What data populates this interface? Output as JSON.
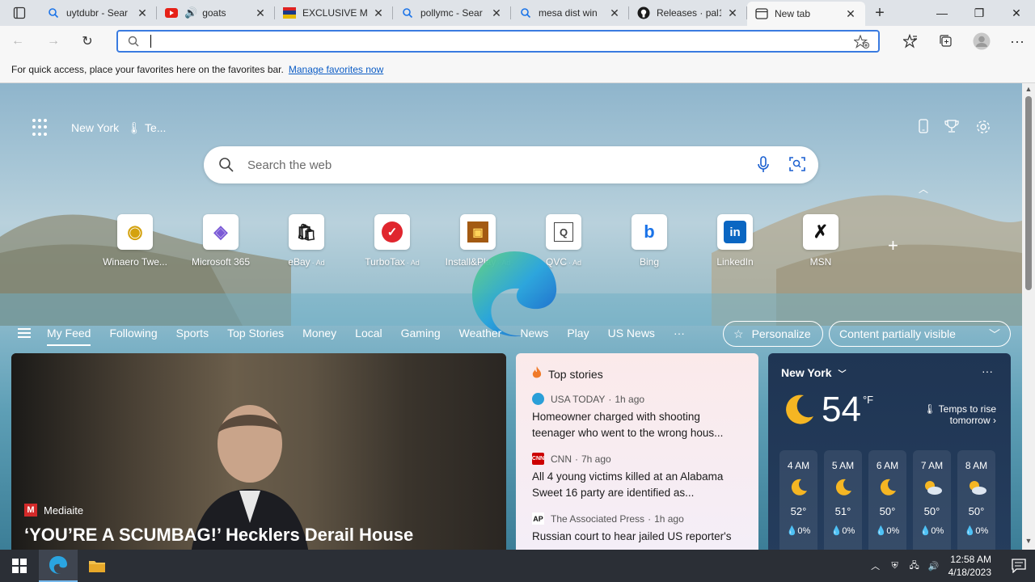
{
  "tabs": [
    {
      "label": "uytdubr - Sear",
      "icon": "bing-search-icon"
    },
    {
      "label": "goats",
      "icon": "youtube-icon"
    },
    {
      "label": "EXCLUSIVE Mr",
      "icon": "news-icon"
    },
    {
      "label": "pollymc - Sear",
      "icon": "bing-search-icon"
    },
    {
      "label": "mesa dist win",
      "icon": "bing-search-icon"
    },
    {
      "label": "Releases · pal1",
      "icon": "github-icon"
    },
    {
      "label": "New tab",
      "icon": "newtab-icon",
      "active": true
    }
  ],
  "address": {
    "value": "",
    "placeholder": ""
  },
  "favorites_bar": {
    "text": "For quick access, place your favorites here on the favorites bar.",
    "link": "Manage favorites now"
  },
  "header": {
    "location": "New York",
    "weather_snippet": "Te..."
  },
  "search": {
    "placeholder": "Search the web"
  },
  "quick_links": [
    {
      "name": "Winaero Twe...",
      "ad": false,
      "glyph": "◉",
      "color": "#d4a20f"
    },
    {
      "name": "Microsoft 365",
      "ad": false,
      "glyph": "◈",
      "color": "#7b5ad6"
    },
    {
      "name": "eBay",
      "ad": true,
      "glyph": "🛍",
      "color": "#1b1b1b"
    },
    {
      "name": "TurboTax",
      "ad": true,
      "glyph": "✓",
      "color": "#e0262e"
    },
    {
      "name": "Install&Play",
      "ad": true,
      "glyph": "▣",
      "color": "#a35a12"
    },
    {
      "name": "QVC",
      "ad": true,
      "glyph": "Q",
      "color": "#444444"
    },
    {
      "name": "Bing",
      "ad": false,
      "glyph": "b",
      "color": "#1a73e8"
    },
    {
      "name": "LinkedIn",
      "ad": false,
      "glyph": "in",
      "color": "#0a66c2"
    },
    {
      "name": "MSN",
      "ad": false,
      "glyph": "✗",
      "color": "#111111"
    }
  ],
  "ad_label": "· Ad",
  "feed_nav": {
    "items": [
      "My Feed",
      "Following",
      "Sports",
      "Top Stories",
      "Money",
      "Local",
      "Gaming",
      "Weather",
      "News",
      "Play",
      "US News"
    ],
    "more": "···",
    "personalize": "Personalize",
    "visibility": "Content partially visible"
  },
  "hero": {
    "source": "Mediaite",
    "headline": "‘YOU’RE A SCUMBAG!’ Hecklers Derail House"
  },
  "top_stories": {
    "title": "Top stories",
    "items": [
      {
        "source": "USA TODAY",
        "age": "1h ago",
        "logo_color": "#2a9fd8",
        "logo_text": "",
        "title": "Homeowner charged with shooting teenager who went to the wrong hous..."
      },
      {
        "source": "CNN",
        "age": "7h ago",
        "logo_color": "#cc0000",
        "logo_text": "CNN",
        "title": "All 4 young victims killed at an Alabama Sweet 16 party are identified as..."
      },
      {
        "source": "The Associated Press",
        "age": "1h ago",
        "logo_color": "#111111",
        "logo_text": "AP",
        "title": "Russian court to hear jailed US reporter's"
      }
    ]
  },
  "weather": {
    "city": "New York",
    "temp": "54",
    "unit": "°F",
    "alert": "Temps to rise tomorrow",
    "hours": [
      {
        "time": "4 AM",
        "icon": "moon-icon",
        "temp": "52°",
        "precip": "0%"
      },
      {
        "time": "5 AM",
        "icon": "moon-icon",
        "temp": "51°",
        "precip": "0%"
      },
      {
        "time": "6 AM",
        "icon": "moon-icon",
        "temp": "50°",
        "precip": "0%"
      },
      {
        "time": "7 AM",
        "icon": "partly-cloudy-icon",
        "temp": "50°",
        "precip": "0%"
      },
      {
        "time": "8 AM",
        "icon": "partly-cloudy-icon",
        "temp": "50°",
        "precip": "0%"
      }
    ]
  },
  "taskbar": {
    "time": "12:58 AM",
    "date": "4/18/2023"
  }
}
